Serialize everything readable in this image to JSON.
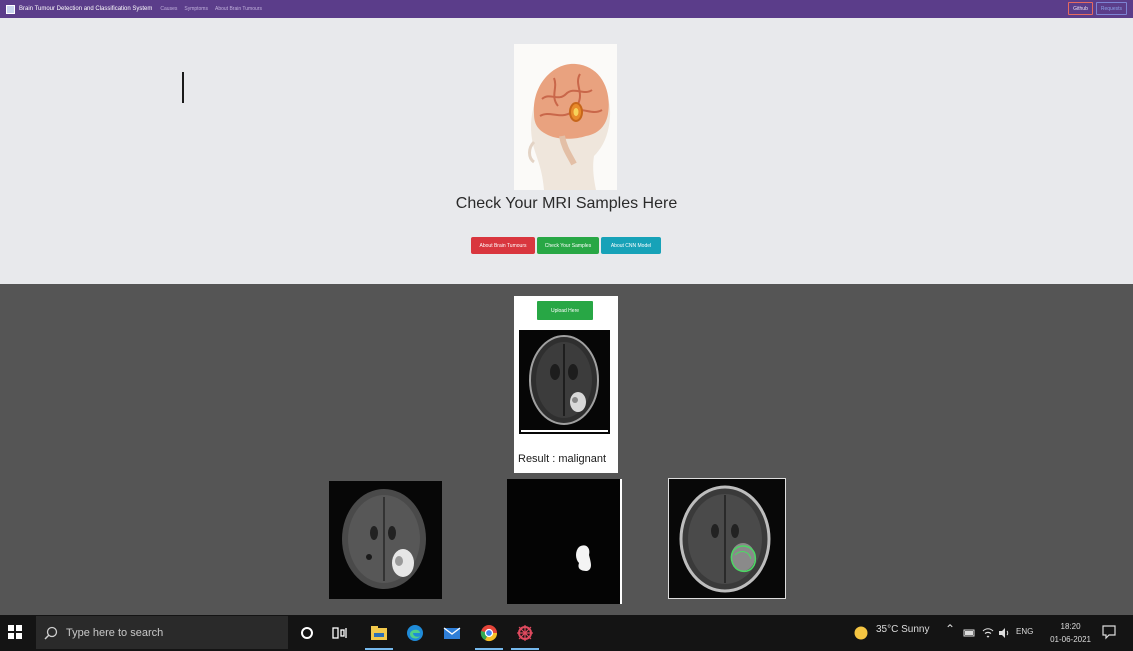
{
  "navbar": {
    "brand": "Brain Tumour Detection and Classification System",
    "links": [
      "Causes",
      "Symptoms",
      "About Brain Tumours"
    ],
    "right_buttons": [
      "Github",
      "Requests"
    ]
  },
  "hero": {
    "title": "Check Your MRI Samples Here",
    "buttons": [
      "About Brain Tumours",
      "Check Your Samples",
      "About CNN Model"
    ]
  },
  "upload": {
    "button_label": "Upload Here",
    "result_text": "Result : malignant"
  },
  "taskbar": {
    "search_placeholder": "Type here to search",
    "weather": "35°C  Sunny",
    "language": "ENG",
    "time": "18:20",
    "date": "01-06-2021"
  },
  "colors": {
    "navbar": "#5b3d8a",
    "hero_bg": "#e8e9ec",
    "dark_bg": "#555555",
    "danger": "#d9363e",
    "success": "#28a745",
    "info": "#17a2b8"
  },
  "icons": [
    "windows-start-icon",
    "search-icon",
    "cortana-icon",
    "task-view-icon",
    "file-explorer-icon",
    "edge-icon",
    "mail-icon",
    "chrome-icon",
    "app-icon",
    "weather-sun-icon",
    "notification-icon"
  ]
}
